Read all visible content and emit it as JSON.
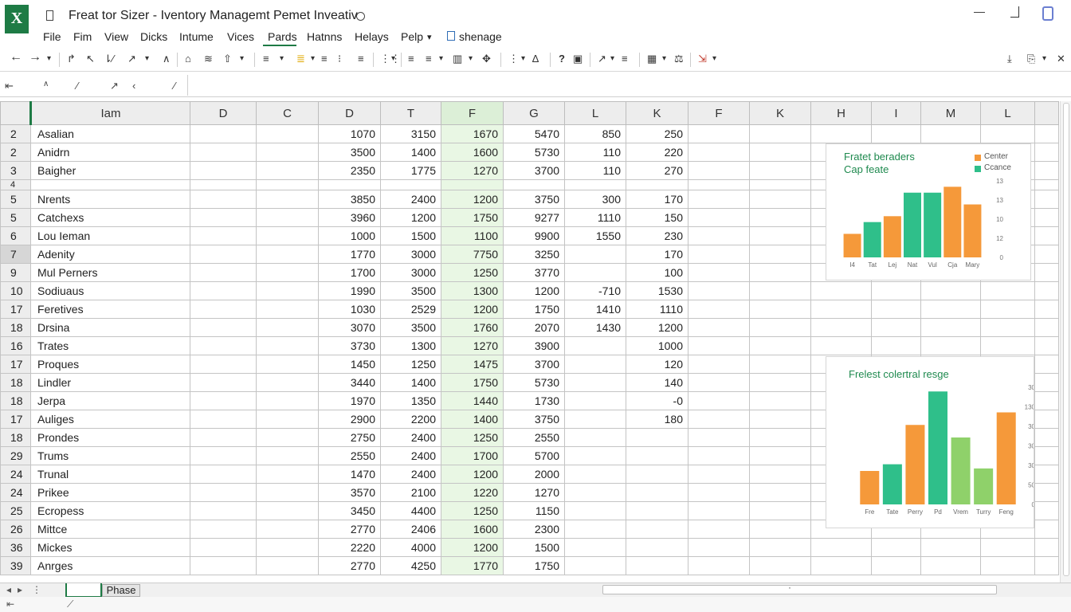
{
  "window": {
    "title": "Freat tor Sizer - Iventory Managemt Pemet Inveativ",
    "logo_letter": "X",
    "controls": {
      "minimize_glyph": "—"
    }
  },
  "menu": {
    "items": [
      "File",
      "Fim",
      "View",
      "Dicks",
      "Intume",
      "Vices",
      "Pards",
      "Hatnns",
      "Helays",
      "Pelp",
      "▾",
      "shenage"
    ],
    "active": "Pards"
  },
  "toolbar": {
    "glyphs": [
      "←",
      "→",
      "▾",
      "↱",
      "↖",
      "⇂⁄",
      "↗",
      "▾",
      "∧",
      "⌂",
      "≋",
      "⇧",
      "▾",
      "≡",
      "▾",
      "≣",
      "▾",
      "≡",
      "⁝",
      "≡",
      "⋮⋮",
      "▾",
      "≡",
      "≡",
      "▾",
      "▥",
      "▾",
      "✥",
      "⋮",
      "▾",
      "∆",
      "?",
      "▣",
      "↗",
      "▾",
      "≡",
      "▦",
      "▾",
      "⚖",
      "⇲",
      "▾",
      "⤓",
      "⎘",
      "▾",
      "✕"
    ]
  },
  "formula_bar": {
    "name_box_glyphs": [
      "⇤",
      "∧"
    ],
    "function_glyphs": [
      "⁄",
      "↗",
      "‹",
      "⁄"
    ],
    "value": ""
  },
  "sheet": {
    "header_label": "Iam",
    "columns": [
      "D",
      "C",
      "D",
      "T",
      "F",
      "G",
      "L",
      "K",
      "F",
      "K",
      "H",
      "I",
      "M",
      "L",
      ""
    ],
    "highlight_column_index": 4,
    "rows": [
      {
        "num": "2",
        "name": "Asalian",
        "vals": [
          "1070",
          "3150",
          "1670",
          "5470",
          "850",
          "250"
        ]
      },
      {
        "num": "2",
        "name": "Anidrn",
        "vals": [
          "3500",
          "1400",
          "1600",
          "5730",
          "110",
          "220"
        ]
      },
      {
        "num": "3",
        "name": "Baigher",
        "vals": [
          "2350",
          "1775",
          "1270",
          "3700",
          "110",
          "270"
        ]
      },
      {
        "num": "4",
        "name": "",
        "vals": [
          "",
          "",
          "",
          "",
          "",
          ""
        ],
        "short": true
      },
      {
        "num": "5",
        "name": "Nrents",
        "vals": [
          "3850",
          "2400",
          "1200",
          "3750",
          "300",
          "170"
        ]
      },
      {
        "num": "5",
        "name": "Catchexs",
        "vals": [
          "3960",
          "1200",
          "1750",
          "9277",
          "1110",
          "150"
        ]
      },
      {
        "num": "6",
        "name": "Lou Ieman",
        "vals": [
          "1000",
          "1500",
          "1100",
          "9900",
          "1550",
          "230"
        ]
      },
      {
        "num": "7",
        "name": "Adenity",
        "vals": [
          "1770",
          "3000",
          "7750",
          "3250",
          "",
          "170"
        ],
        "selected": true
      },
      {
        "num": "9",
        "name": "Mul Perners",
        "vals": [
          "1700",
          "3000",
          "1250",
          "3770",
          "",
          "100"
        ]
      },
      {
        "num": "10",
        "name": "Sodiuaus",
        "vals": [
          "1990",
          "3500",
          "1300",
          "1200",
          "-710",
          "1530"
        ]
      },
      {
        "num": "17",
        "name": "Feretives",
        "vals": [
          "1030",
          "2529",
          "1200",
          "1750",
          "1410",
          "1110"
        ]
      },
      {
        "num": "18",
        "name": "Drsina",
        "vals": [
          "3070",
          "3500",
          "1760",
          "2070",
          "1430",
          "1200"
        ]
      },
      {
        "num": "16",
        "name": "Trates",
        "vals": [
          "3730",
          "1300",
          "1270",
          "3900",
          "",
          "1000"
        ]
      },
      {
        "num": "17",
        "name": "Proques",
        "vals": [
          "1450",
          "1250",
          "1475",
          "3700",
          "",
          "120"
        ]
      },
      {
        "num": "18",
        "name": "Lindler",
        "vals": [
          "3440",
          "1400",
          "1750",
          "5730",
          "",
          "140"
        ]
      },
      {
        "num": "18",
        "name": "Jerpa",
        "vals": [
          "1970",
          "1350",
          "1440",
          "1730",
          "",
          "-0"
        ]
      },
      {
        "num": "17",
        "name": "Auliges",
        "vals": [
          "2900",
          "2200",
          "1400",
          "3750",
          "",
          "180"
        ]
      },
      {
        "num": "18",
        "name": "Prondes",
        "vals": [
          "2750",
          "2400",
          "1250",
          "2550",
          "",
          ""
        ]
      },
      {
        "num": "29",
        "name": "Trums",
        "vals": [
          "2550",
          "2400",
          "1700",
          "5700",
          "",
          ""
        ]
      },
      {
        "num": "24",
        "name": "Trunal",
        "vals": [
          "1470",
          "2400",
          "1200",
          "2000",
          "",
          ""
        ]
      },
      {
        "num": "24",
        "name": "Prikee",
        "vals": [
          "3570",
          "2100",
          "1220",
          "1270",
          "",
          ""
        ]
      },
      {
        "num": "25",
        "name": "Ecropess",
        "vals": [
          "3450",
          "4400",
          "1250",
          "1150",
          "",
          ""
        ]
      },
      {
        "num": "26",
        "name": "Mittce",
        "vals": [
          "2770",
          "2406",
          "1600",
          "2300",
          "",
          ""
        ]
      },
      {
        "num": "36",
        "name": "Mickes",
        "vals": [
          "2220",
          "4000",
          "1200",
          "1500",
          "",
          ""
        ]
      },
      {
        "num": "39",
        "name": "Anrges",
        "vals": [
          "2770",
          "4250",
          "1770",
          "1750",
          "",
          ""
        ]
      }
    ]
  },
  "charts": {
    "top": {
      "title_line1": "Fratet beraders",
      "title_line2": "Cap feate",
      "legend": [
        {
          "label": "Center",
          "color": "#f5993a"
        },
        {
          "label": "Ccance",
          "color": "#2fbf8a"
        }
      ],
      "y_ticks": [
        "13",
        "13",
        "10",
        "12",
        "0"
      ],
      "categories": [
        "I4",
        "Tat",
        "Lej",
        "Nat",
        "Vul",
        "Cja",
        "Mary"
      ]
    },
    "bottom": {
      "title": "Frelest colertral resge",
      "y_ticks": [
        "30",
        "130",
        "30",
        "30",
        "30",
        "50",
        "0"
      ],
      "categories": [
        "Fre",
        "Tate",
        "Perry",
        "Pd",
        "Vrem",
        "Turry",
        "Feng"
      ]
    }
  },
  "chart_data": [
    {
      "type": "bar",
      "title": "Fratet beraders",
      "subtitle": "Cap feate",
      "categories": [
        "I4",
        "Tat",
        "Lej",
        "Nat",
        "Vul",
        "Cja",
        "Mary"
      ],
      "values": [
        4,
        6,
        7,
        11,
        11,
        12,
        9
      ],
      "colors": [
        "#f5993a",
        "#2fbf8a",
        "#f5993a",
        "#2fbf8a",
        "#2fbf8a",
        "#f5993a",
        "#f5993a"
      ],
      "legend": [
        "Center",
        "Ccance"
      ],
      "legend_position": "top-right",
      "ylim": [
        0,
        13
      ]
    },
    {
      "type": "bar",
      "title": "Frelest colertral resge",
      "categories": [
        "Fre",
        "Tate",
        "Perry",
        "Pd",
        "Vrem",
        "Turry",
        "Feng"
      ],
      "values": [
        40,
        48,
        95,
        135,
        80,
        43,
        110
      ],
      "colors": [
        "#f5993a",
        "#2fbf8a",
        "#f5993a",
        "#2fbf8a",
        "#8fd16a",
        "#8fd16a",
        "#f5993a"
      ],
      "ylim": [
        0,
        140
      ]
    }
  ],
  "bottom_bar": {
    "tabs": [
      "",
      "Phase"
    ],
    "nav_glyphs": [
      "◂",
      "▸",
      "⋮"
    ],
    "status_glyphs": [
      "⇤",
      "⟋"
    ],
    "scroll_mark": "·"
  }
}
